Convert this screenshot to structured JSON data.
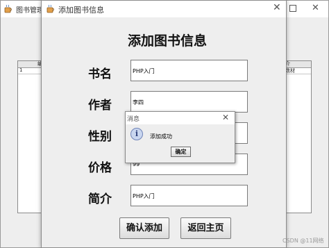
{
  "background_window": {
    "title": "图书管理系统",
    "table": {
      "header_left": "编",
      "header_right": "介",
      "row_left": "1",
      "row_right": "数材"
    }
  },
  "dialog": {
    "title": "添加图书信息",
    "heading": "添加图书信息",
    "fields": [
      {
        "label": "书名",
        "value": "PHP入门"
      },
      {
        "label": "作者",
        "value": "李四"
      },
      {
        "label": "性别",
        "value": ""
      },
      {
        "label": "价格",
        "value": "99"
      },
      {
        "label": "简介",
        "value": "PHP入门"
      }
    ],
    "confirm_label": "确认添加",
    "back_label": "返回主页"
  },
  "message": {
    "title": "消息",
    "text": "添加成功",
    "ok_label": "确定",
    "icon": "info-icon"
  },
  "watermark": "CSDN @11网络"
}
